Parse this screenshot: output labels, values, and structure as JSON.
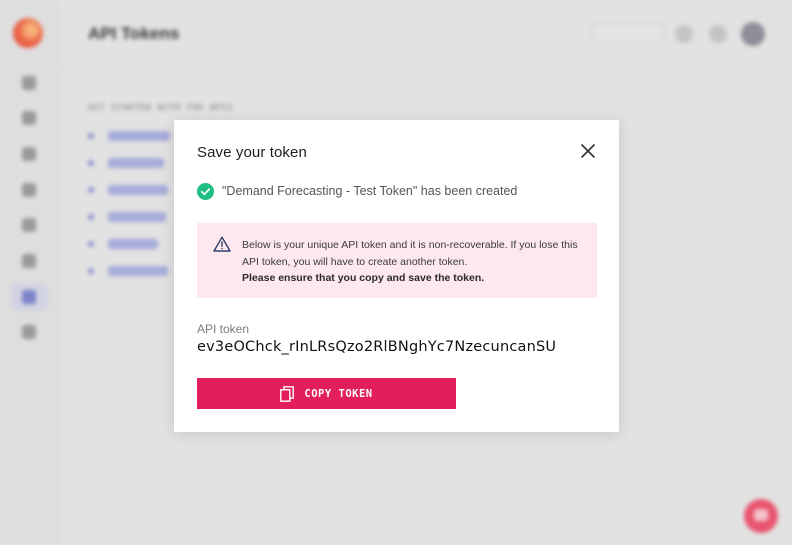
{
  "background": {
    "page_title": "API Tokens",
    "section_label": "GET STARTED WITH THE APIS"
  },
  "modal": {
    "title": "Save your token",
    "success_message": "\"Demand Forecasting - Test Token\" has been created",
    "warning": {
      "text": "Below is your unique API token and it is non-recoverable. If you lose this API token, you will have to create another token.",
      "emphasis": "Please ensure that you copy and save the token."
    },
    "token_label": "API token",
    "token_value": "ev3eOChck_rInLRsQzo2RlBNghYc7NzecuncanSU",
    "copy_button_label": "COPY TOKEN"
  },
  "colors": {
    "accent": "#e21f5b",
    "success": "#1fbf84",
    "warning_bg": "#fde8ee"
  },
  "icons": {
    "close": "close-icon",
    "check": "check-circle-icon",
    "warning": "warning-triangle-icon",
    "copy": "copy-icon"
  }
}
